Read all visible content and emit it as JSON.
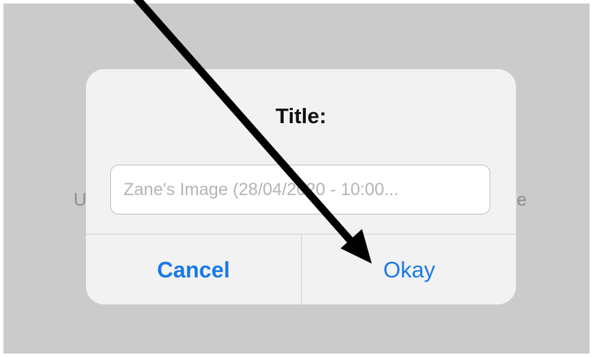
{
  "background": {
    "left_text": "U",
    "right_text": "e"
  },
  "dialog": {
    "title": "Title:",
    "input": {
      "placeholder": "Zane's Image (28/04/2020 - 10:00...",
      "value": ""
    },
    "buttons": {
      "cancel_label": "Cancel",
      "okay_label": "Okay"
    }
  },
  "annotation": {
    "type": "arrow",
    "color": "#000000",
    "points_to": "okay-button"
  },
  "colors": {
    "backdrop": "#cbcbcb",
    "dialog": "#f2f2f2",
    "accent": "#1a7ae6"
  }
}
